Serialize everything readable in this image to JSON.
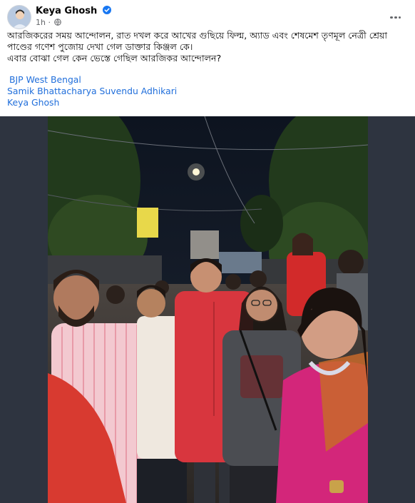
{
  "post": {
    "author": "Keya Ghosh",
    "time": "1h",
    "text_line_1": "আরজিকরের সময় আন্দোলন,  রাত দখল করে আখের গুছিয়ে ফিল্ম, অ্যাড এবং শেষমেশ তৃণমূল নেত্রী শ্রেয়া",
    "text_line_2": "পাণ্ডের গণেশ পুজোয় দেখা গেল ডাক্তার কিঞ্জল কে।",
    "text_line_3": "এবার বোঝা গেল কেন ভেস্তে গেছিল আরজিকর আন্দোলন?",
    "tags": [
      "BJP West Bengal",
      "Samik Bhattacharya Suvendu Adhikari",
      "Keya Ghosh"
    ]
  },
  "icons": {
    "verified": "verified-badge-icon",
    "audience": "globe-icon",
    "more": "more-options-icon"
  },
  "colors": {
    "link": "#216fdb",
    "verified": "#1877f2",
    "meta": "#65676b",
    "media_bg": "#2e3440"
  }
}
